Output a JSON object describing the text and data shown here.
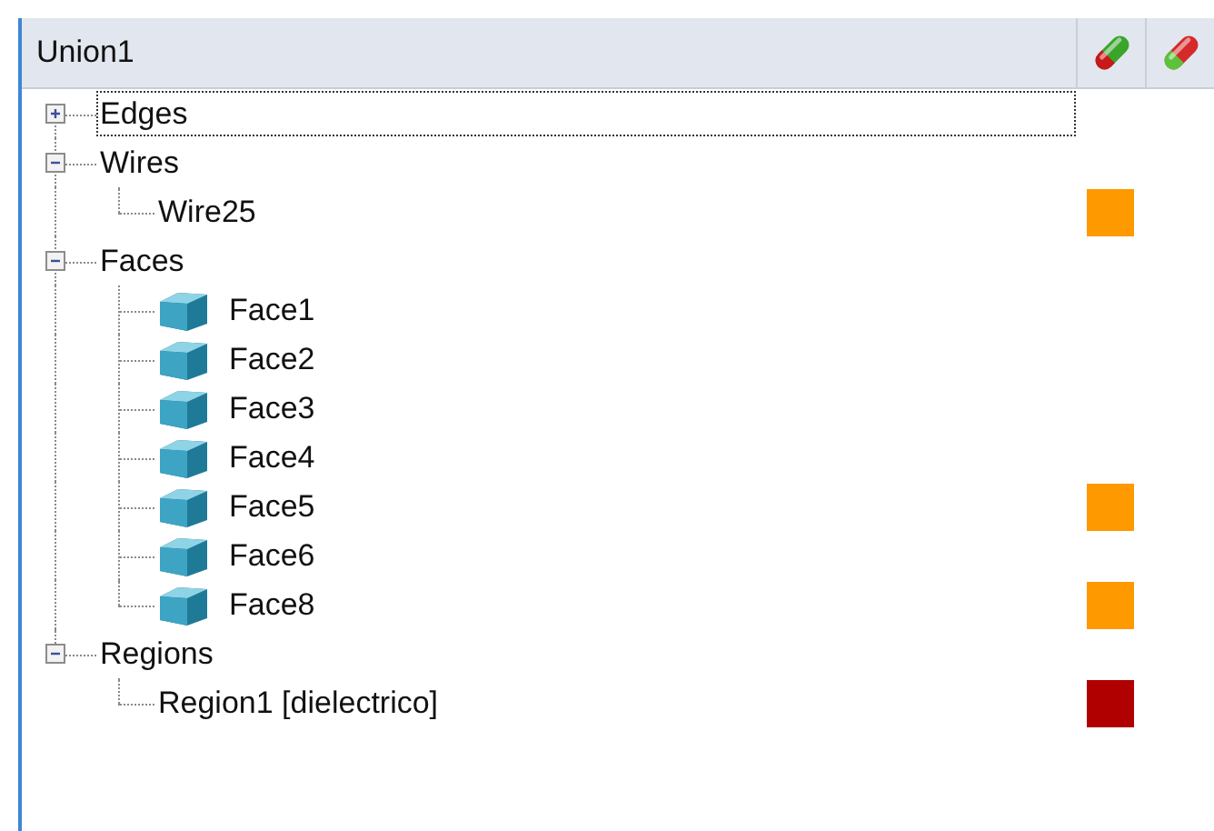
{
  "header": {
    "title": "Union1"
  },
  "tree": [
    {
      "label": "Edges",
      "kind": "group",
      "expanded": false,
      "focused": true
    },
    {
      "label": "Wires",
      "kind": "group",
      "expanded": true,
      "focused": false,
      "children": [
        {
          "label": "Wire25",
          "kind": "wire",
          "focused": false,
          "color": "#ff9900"
        }
      ]
    },
    {
      "label": "Faces",
      "kind": "group",
      "expanded": true,
      "focused": false,
      "children": [
        {
          "label": "Face1",
          "kind": "face",
          "focused": false
        },
        {
          "label": "Face2",
          "kind": "face",
          "focused": false
        },
        {
          "label": "Face3",
          "kind": "face",
          "focused": false
        },
        {
          "label": "Face4",
          "kind": "face",
          "focused": false
        },
        {
          "label": "Face5",
          "kind": "face",
          "focused": false,
          "color": "#ff9900"
        },
        {
          "label": "Face6",
          "kind": "face",
          "focused": false
        },
        {
          "label": "Face8",
          "kind": "face",
          "focused": false,
          "color": "#ff9900"
        }
      ]
    },
    {
      "label": "Regions",
      "kind": "group",
      "expanded": true,
      "focused": false,
      "children": [
        {
          "label": "Region1 [dielectrico]",
          "kind": "region",
          "focused": false,
          "color": "#b00000"
        }
      ]
    }
  ]
}
